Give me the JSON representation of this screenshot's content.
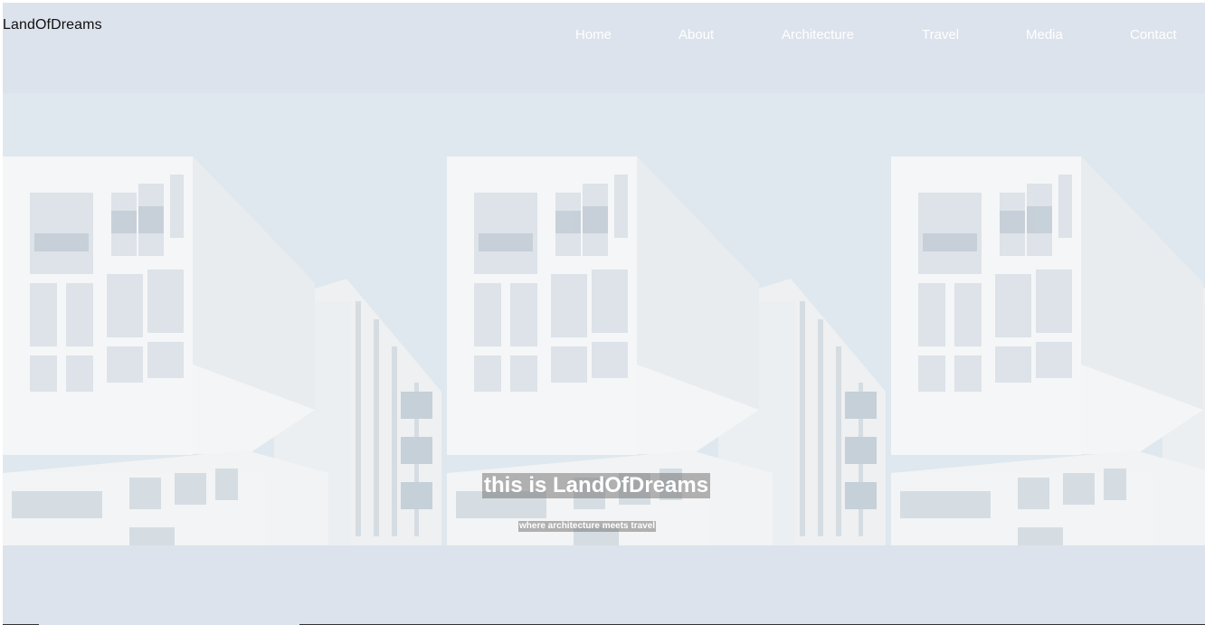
{
  "brand": {
    "name": "LandOfDreams"
  },
  "nav": {
    "items": [
      "Home",
      "About",
      "Architecture",
      "Travel",
      "Media",
      "Contact"
    ]
  },
  "hero": {
    "title": "this is LandOfDreams",
    "subtitle": "where architecture meets travel",
    "image": "white-modern-building"
  },
  "colors": {
    "page_background": "#dce3ec",
    "sky": "#dfe8ee",
    "building": "#f3f4f5",
    "nav_text": "#ffffff"
  }
}
